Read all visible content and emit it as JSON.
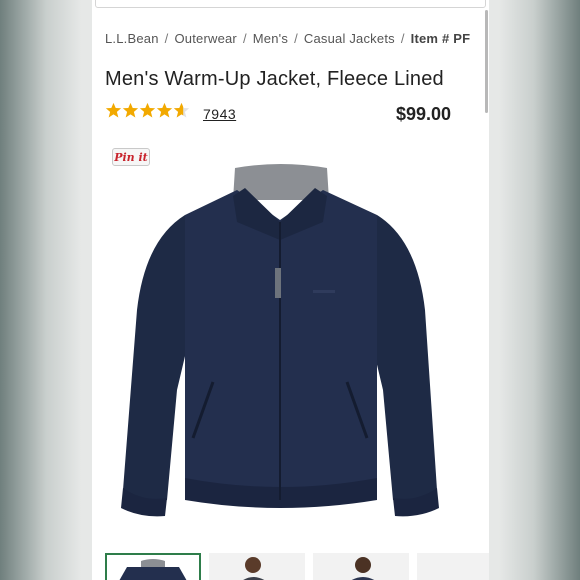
{
  "breadcrumb": {
    "items": [
      "L.L.Bean",
      "Outerwear",
      "Men's",
      "Casual Jackets"
    ],
    "item_number": "Item # PF"
  },
  "product": {
    "title": "Men's Warm-Up Jacket, Fleece Lined",
    "rating": 4.6,
    "rating_max": 5,
    "review_count": "7943",
    "price": "$99.00"
  },
  "pin_button": {
    "label": "Pin it"
  },
  "colors": {
    "star": "#f2a900",
    "jacket": "#232f4e",
    "fleece": "#8c8f94",
    "thumb_active_border": "#2e7d4a",
    "pin": "#c8232c"
  },
  "icons": {
    "rating": "star-icon",
    "pin": "pinterest-icon"
  },
  "thumbnails": {
    "count_visible": 4,
    "active_index": 0
  }
}
